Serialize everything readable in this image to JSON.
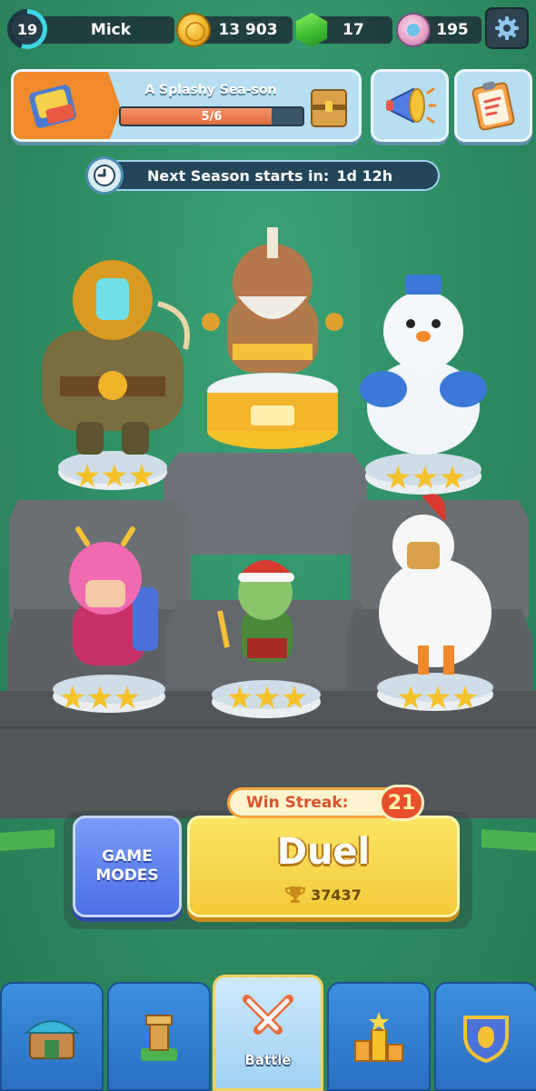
{
  "player": {
    "level": "19",
    "name": "Mick",
    "level_progress": 0.55
  },
  "resources": {
    "coins": "13 903",
    "gems": "17",
    "tokens": "195"
  },
  "season": {
    "title": "A Splashy Sea-son",
    "progress_text": "5/6",
    "progress_fraction": 0.83
  },
  "timer": {
    "label": "Next Season starts in:",
    "value": "1d 12h"
  },
  "figures": [
    {
      "name": "diver",
      "stars": 3
    },
    {
      "name": "bearded-warrior",
      "stars": 3
    },
    {
      "name": "snowman",
      "stars": 3
    },
    {
      "name": "pink-archer",
      "stars": 3
    },
    {
      "name": "goblin-santa",
      "stars": 3
    },
    {
      "name": "chicken-warrior",
      "stars": 3
    }
  ],
  "game_modes": {
    "label_line1": "GAME",
    "label_line2": "MODES"
  },
  "duel": {
    "label": "Duel",
    "trophies": "37437"
  },
  "win_streak": {
    "label": "Win Streak:",
    "value": "21"
  },
  "nav": {
    "battle_label": "Battle"
  },
  "colors": {
    "background": "#2f8f66",
    "duel_yellow": "#f3c936",
    "game_modes_blue": "#4a6fe6",
    "season_orange": "#f08a2c",
    "nav_blue": "#2b6fc0"
  }
}
